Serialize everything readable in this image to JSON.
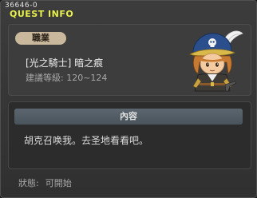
{
  "quest_id": "36646-0",
  "window_title": "QUEST INFO",
  "info": {
    "job_badge": "職業",
    "job_name": "[光之騎士] 暗之痕",
    "level_label": "建議等級:",
    "level_range": "120~124"
  },
  "content": {
    "header": "內容",
    "text": "胡克召唤我。去圣地看看吧。"
  },
  "status": {
    "label": "狀態:",
    "value": "可開始"
  },
  "character": {
    "icon": "mihile-knight-portrait",
    "colors": {
      "hat": "#2b4f8c",
      "hair": "#c77b32",
      "feather": "#f2f2f2"
    }
  }
}
